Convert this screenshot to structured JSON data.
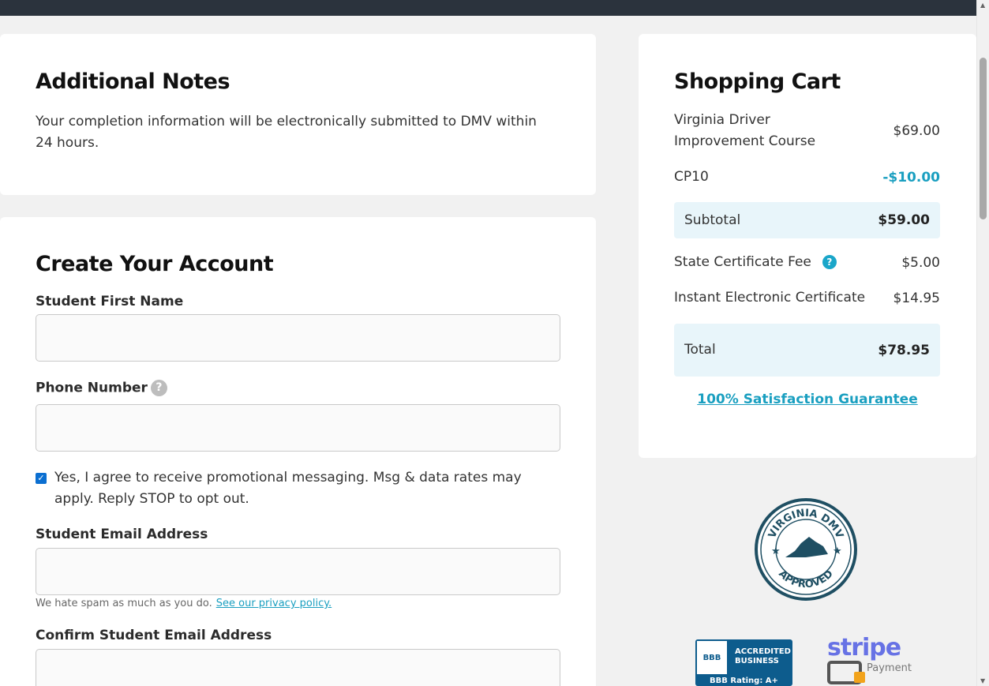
{
  "notes": {
    "title": "Additional Notes",
    "text": "Your completion information will be electronically submitted to DMV within 24 hours."
  },
  "account": {
    "title": "Create Your Account",
    "first_name_label": "Student First Name",
    "phone_label": "Phone Number",
    "phone_help": "?",
    "consent_text": "Yes, I agree to receive promotional messaging. Msg & data rates may apply. Reply STOP to opt out.",
    "consent_checked": true,
    "email_label": "Student Email Address",
    "email_hint": "We hate spam as much as you do.",
    "privacy_link": "See our privacy policy.",
    "confirm_email_label": "Confirm Student Email Address"
  },
  "cart": {
    "title": "Shopping Cart",
    "course_label": "Virginia Driver Improvement Course",
    "course_price": "$69.00",
    "coupon_label": "CP10",
    "coupon_amount": "-$10.00",
    "subtotal_label": "Subtotal",
    "subtotal_amount": "$59.00",
    "state_fee_label": "State Certificate Fee",
    "state_fee_help": "?",
    "state_fee_amount": "$5.00",
    "instant_cert_label": "Instant Electronic Certificate",
    "instant_cert_amount": "$14.95",
    "total_label": "Total",
    "total_amount": "$78.95",
    "guarantee_link": "100% Satisfaction Guarantee"
  },
  "badges": {
    "dmv_top": "VIRGINIA DMV",
    "dmv_bottom": "APPROVED",
    "bbb_logo": "BBB",
    "bbb_line1": "ACCREDITED",
    "bbb_line2": "BUSINESS",
    "bbb_rating": "BBB Rating: A+",
    "stripe_word": "stripe",
    "stripe_payment": "Payment"
  },
  "colors": {
    "accent": "#1a9fc0",
    "topbar": "#2b333d",
    "checkbox": "#0b6fd1",
    "shaded_row": "#e8f5fa"
  }
}
